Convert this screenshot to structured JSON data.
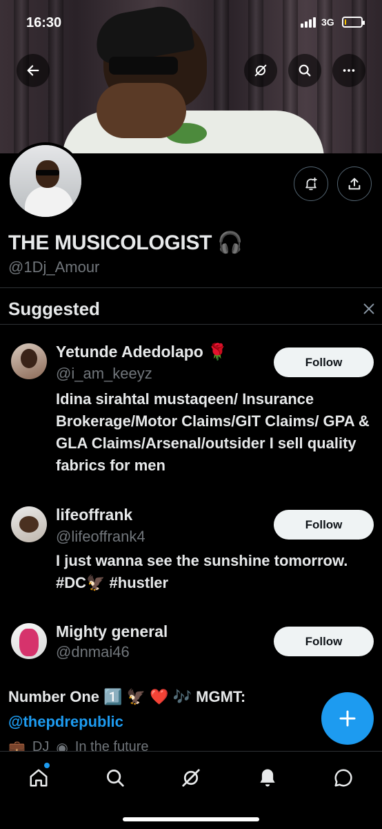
{
  "status_bar": {
    "time": "16:30",
    "network": "3G",
    "battery_level": 0.1
  },
  "colors": {
    "accent": "#1d9bf0",
    "background": "#000000",
    "secondary_text": "#71767b",
    "battery": "#f5c400"
  },
  "header": {
    "back_icon": "arrow-left-icon",
    "grok_icon": "grok-icon",
    "search_icon": "search-icon",
    "more_icon": "more-icon"
  },
  "profile": {
    "name": "THE MUSICOLOGIST 🎧",
    "handle": "@1Dj_Amour",
    "bio": "Number One 1️⃣ 🦅 ❤️ 🎶 MGMT:",
    "bio_link": "@thepdrepublic",
    "category": "DJ",
    "location": "In the future"
  },
  "suggested": {
    "title": "Suggested",
    "users": [
      {
        "name": "Yetunde Adedolapo 🌹",
        "handle": "@i_am_keeyz",
        "bio": "Idina sirahtal mustaqeen/ Insurance Brokerage/Motor Claims/GIT Claims/ GPA & GLA Claims/Arsenal/outsider I sell quality fabrics for men",
        "follow_label": "Follow"
      },
      {
        "name": "lifeoffrank",
        "handle": "@lifeoffrank4",
        "bio": "I just wanna see the sunshine tomorrow. #DC🦅 #hustler",
        "follow_label": "Follow"
      },
      {
        "name": "Mighty general",
        "handle": "@dnmai46",
        "bio": "",
        "follow_label": "Follow"
      }
    ]
  },
  "nav": {
    "items": [
      "home-icon",
      "search-icon",
      "grok-icon",
      "notifications-icon",
      "messages-icon"
    ]
  }
}
